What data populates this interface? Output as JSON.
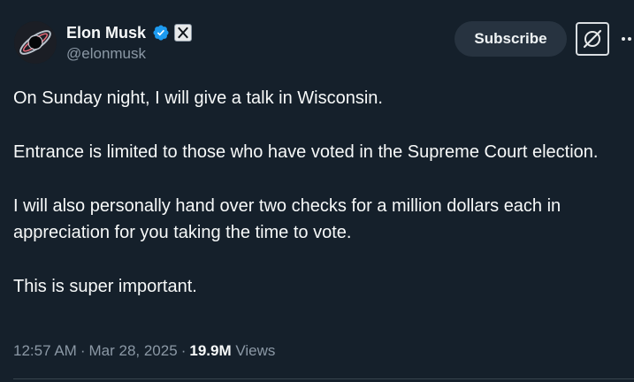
{
  "author": {
    "name": "Elon Musk",
    "handle": "@elonmusk",
    "verified_icon": "verified-badge-icon",
    "affiliation_icon": "x-logo-icon",
    "avatar": "avatar-image"
  },
  "actions": {
    "subscribe_label": "Subscribe",
    "grok_icon": "grok-icon",
    "more_icon": "more-dots-icon"
  },
  "tweet": {
    "paragraphs": [
      "On Sunday night, I will give a talk in Wisconsin.",
      "Entrance is limited to those who have voted in the Supreme Court election.",
      "I will also personally hand over two checks for a million dollars each in appreciation for you taking the time to vote.",
      "This is super important."
    ]
  },
  "meta": {
    "time": "12:57 AM",
    "date": "Mar 28, 2025",
    "views_count": "19.9M",
    "views_label": "Views",
    "separator": "·"
  },
  "colors": {
    "background": "#15202b",
    "text": "#f7f9f9",
    "secondary_text": "#8b98a5",
    "verified": "#1d9bf0",
    "subscribe_bg": "#273340"
  }
}
